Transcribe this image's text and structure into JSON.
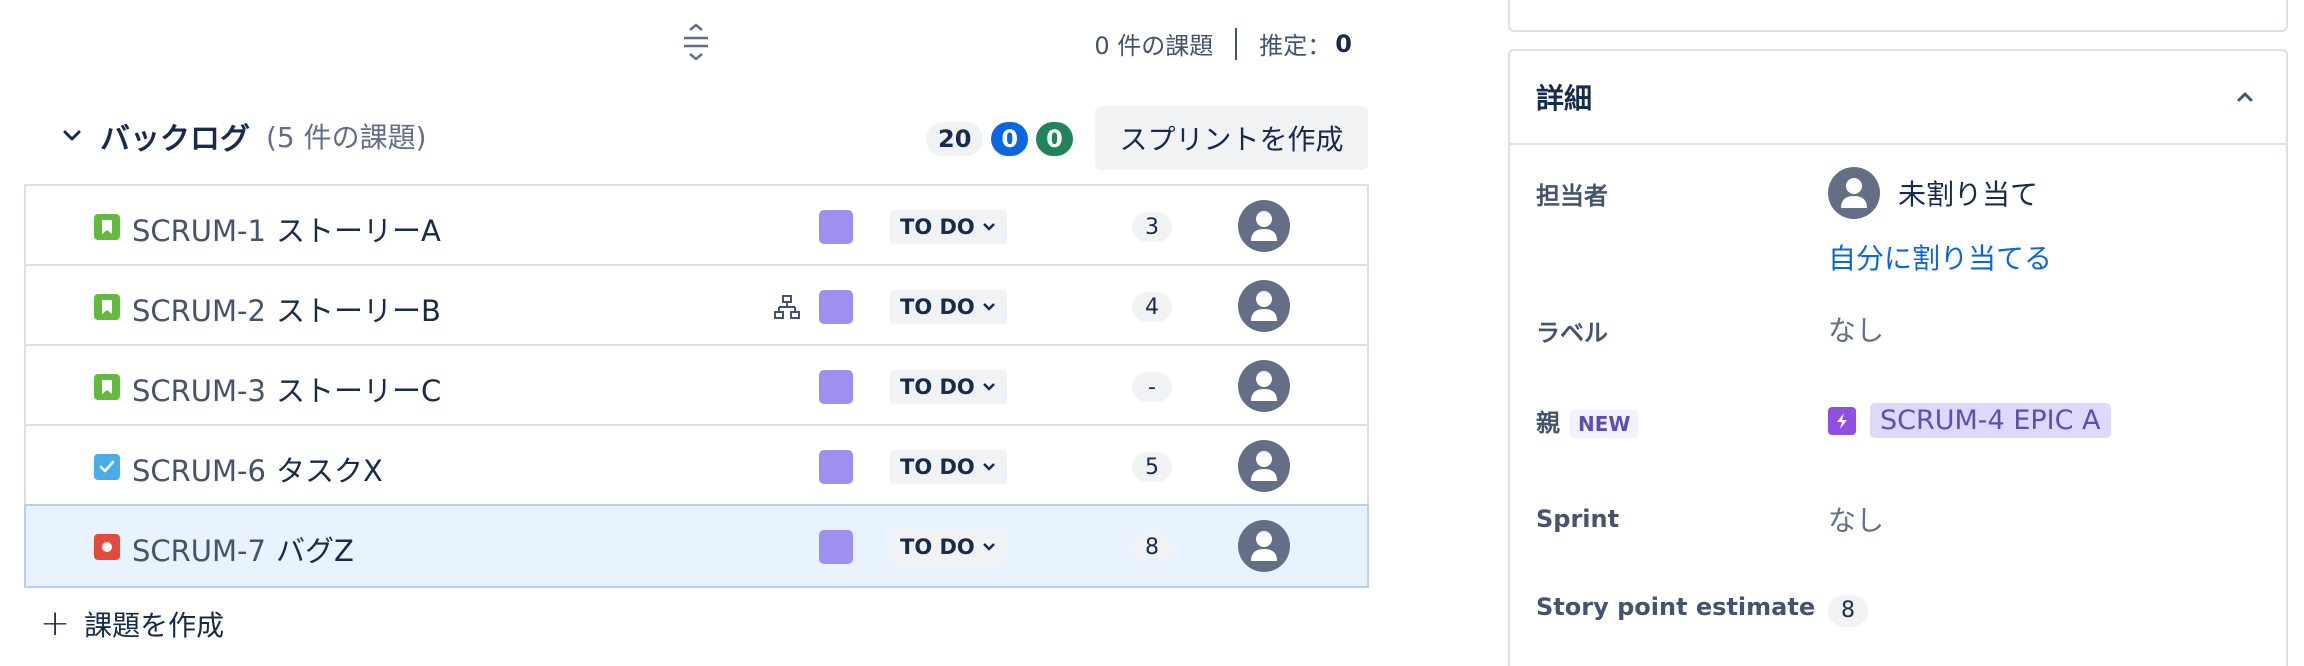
{
  "sprint_summary": {
    "issue_count": "0 件の課題",
    "estimate_label": "推定：",
    "estimate_value": "0"
  },
  "backlog": {
    "title": "バックログ",
    "count": "(5 件の課題)",
    "badges": {
      "not_started": "20",
      "in_progress": "0",
      "done": "0"
    },
    "create_sprint": "スプリントを作成",
    "create_issue": "課題を作成",
    "issues": [
      {
        "key": "SCRUM-1",
        "summary": "ストーリーA",
        "type": "story",
        "status": "TO DO",
        "points": "3",
        "has_child": false
      },
      {
        "key": "SCRUM-2",
        "summary": "ストーリーB",
        "type": "story",
        "status": "TO DO",
        "points": "4",
        "has_child": true
      },
      {
        "key": "SCRUM-3",
        "summary": "ストーリーC",
        "type": "story",
        "status": "TO DO",
        "points": "-",
        "has_child": false
      },
      {
        "key": "SCRUM-6",
        "summary": "タスクX",
        "type": "task",
        "status": "TO DO",
        "points": "5",
        "has_child": false
      },
      {
        "key": "SCRUM-7",
        "summary": "バグZ",
        "type": "bug",
        "status": "TO DO",
        "points": "8",
        "has_child": false,
        "selected": true
      }
    ]
  },
  "details": {
    "title": "詳細",
    "assignee_label": "担当者",
    "assignee_value": "未割り当て",
    "assign_to_me": "自分に割り当てる",
    "labels_label": "ラベル",
    "labels_value": "なし",
    "parent_label": "親",
    "parent_new": "NEW",
    "parent_value": "SCRUM-4 EPIC A",
    "sprint_label": "Sprint",
    "sprint_value": "なし",
    "story_points_label": "Story point estimate",
    "story_points_value": "8"
  },
  "colors": {
    "accent_blue": "#0c66e4",
    "done_green": "#1f845a",
    "epic_purple": "#9f8fef",
    "selected_row": "#e9f2ff"
  }
}
